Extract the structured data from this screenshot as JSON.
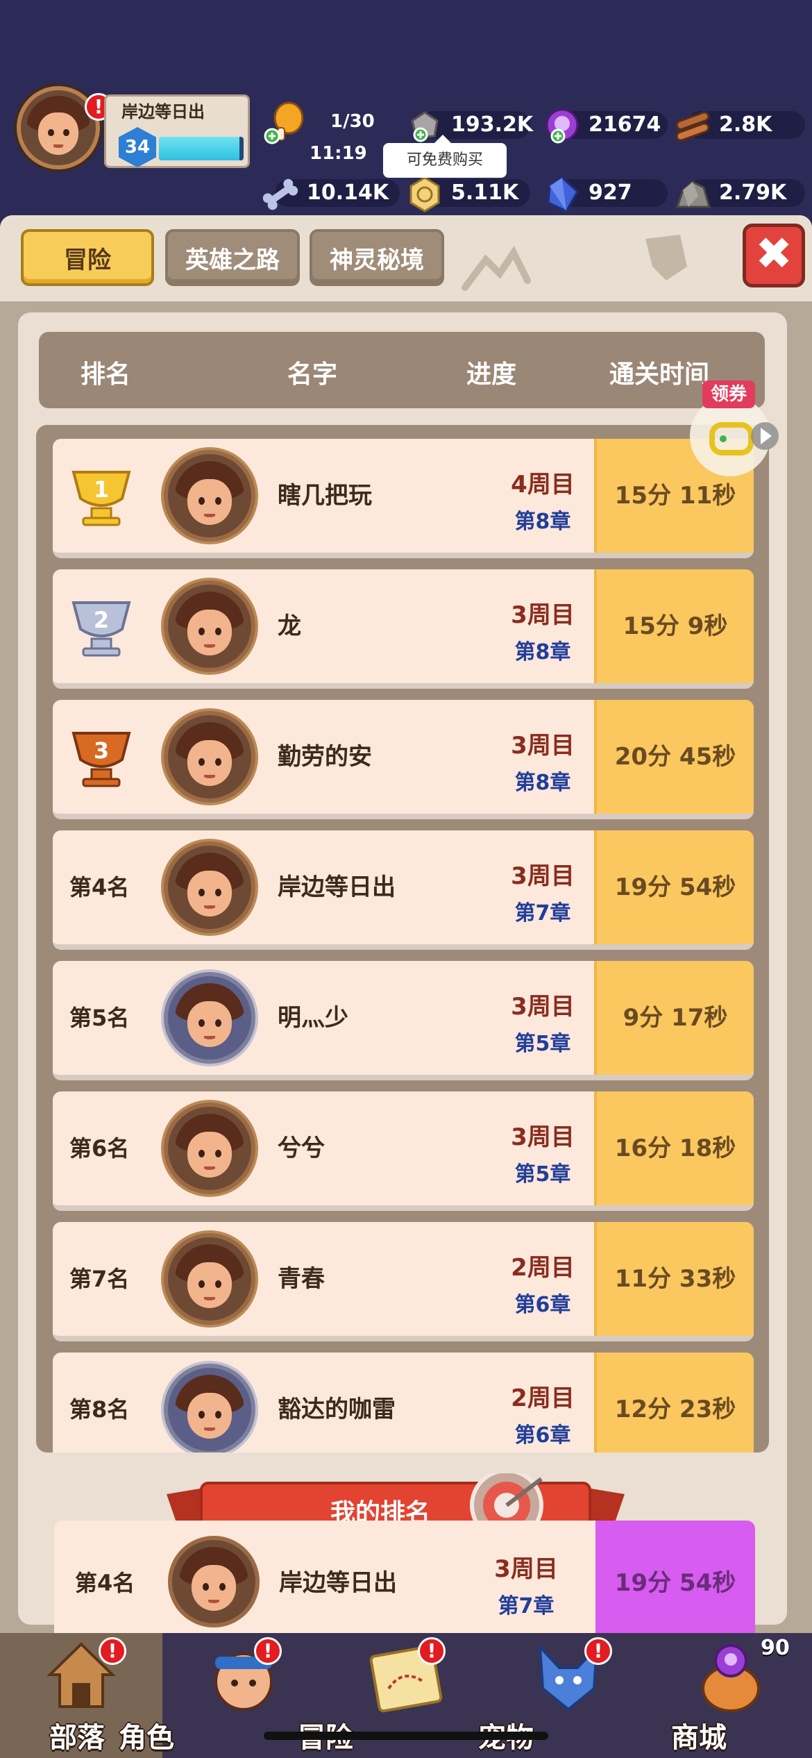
{
  "player": {
    "name": "岸边等日出",
    "level": "34",
    "xp_fraction": 0.95
  },
  "resources": {
    "stamina": "1/30",
    "stamina_timer": "11:19",
    "ore": "193.2K",
    "gems_purple": "21674",
    "wood": "2.8K",
    "bone": "10.14K",
    "coin": "5.11K",
    "crystal": "927",
    "stone": "2.79K"
  },
  "tooltip": "可免费购买",
  "tabs": [
    {
      "label": "冒险",
      "active": true
    },
    {
      "label": "英雄之路",
      "active": false
    },
    {
      "label": "神灵秘境",
      "active": false
    }
  ],
  "table_headers": {
    "rank": "排名",
    "name": "名字",
    "progress": "进度",
    "time": "通关时间"
  },
  "coupon_label": "领券",
  "rows": [
    {
      "rank": "1",
      "name": "瞎几把玩",
      "cycle": "4周目",
      "chapter": "第8章",
      "time": "15分 11秒"
    },
    {
      "rank": "2",
      "name": "龙",
      "cycle": "3周目",
      "chapter": "第8章",
      "time": "15分 9秒"
    },
    {
      "rank": "3",
      "name": "勤劳的安",
      "cycle": "3周目",
      "chapter": "第8章",
      "time": "20分 45秒"
    },
    {
      "rank": "第4名",
      "name": "岸边等日出",
      "cycle": "3周目",
      "chapter": "第7章",
      "time": "19分 54秒"
    },
    {
      "rank": "第5名",
      "name": "明灬少",
      "cycle": "3周目",
      "chapter": "第5章",
      "time": "9分 17秒"
    },
    {
      "rank": "第6名",
      "name": "兮兮",
      "cycle": "3周目",
      "chapter": "第5章",
      "time": "16分 18秒"
    },
    {
      "rank": "第7名",
      "name": "青春",
      "cycle": "2周目",
      "chapter": "第6章",
      "time": "11分 33秒"
    },
    {
      "rank": "第8名",
      "name": "豁达的咖雷",
      "cycle": "2周目",
      "chapter": "第6章",
      "time": "12分 23秒"
    }
  ],
  "my_rank": {
    "title": "我的排名",
    "rank": "第4名",
    "name": "岸边等日出",
    "cycle": "3周目",
    "chapter": "第7章",
    "time": "19分 54秒"
  },
  "nav": [
    {
      "label": "部落",
      "icon": "tribe-icon"
    },
    {
      "label": "角色",
      "icon": "character-icon"
    },
    {
      "label": "冒险",
      "icon": "map-icon"
    },
    {
      "label": "宠物",
      "icon": "pet-icon"
    },
    {
      "label": "商城",
      "icon": "shop-icon"
    }
  ],
  "shop_badge_count": "90",
  "alert_mark": "!",
  "close_glyph": "✖"
}
